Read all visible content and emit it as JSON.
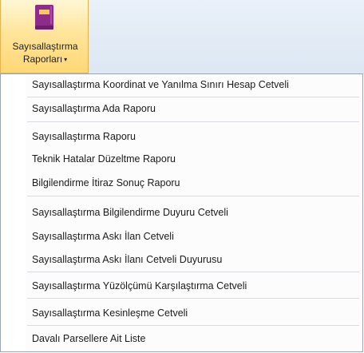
{
  "ribbon": {
    "button": {
      "label_line1": "Sayısallaştırma",
      "label_line2": "Raporları",
      "dropdown_arrow": "▾",
      "icon": "report-book-icon",
      "icon_color": "#8e2c8a",
      "highlight_color": "#ffe59a"
    }
  },
  "menu": {
    "items": [
      {
        "label": "Sayısallaştırma Koordinat ve Yanılma Sınırı Hesap Cetveli"
      },
      {
        "label": "Sayısallaştırma Ada Raporu"
      },
      {
        "label": "Sayısallaştırma Raporu"
      },
      {
        "label": "Teknik Hatalar Düzeltme Raporu"
      },
      {
        "label": "Bilgilendirme İtiraz Sonuç Raporu"
      },
      {
        "label": "Sayısallaştırma Bilgilendirme Duyuru Cetveli"
      },
      {
        "label": "Sayısallaştırma Askı İlan Cetveli"
      },
      {
        "label": "Sayısallaştırma Askı İlanı Cetveli Duyurusu"
      },
      {
        "label": "Sayısallaştırma Yüzölçümü Karşılaştırma Cetveli"
      },
      {
        "label": "Sayısallaştırma Kesinleşme Cetveli"
      },
      {
        "label": "Davalı Parsellere Ait Liste"
      }
    ]
  }
}
